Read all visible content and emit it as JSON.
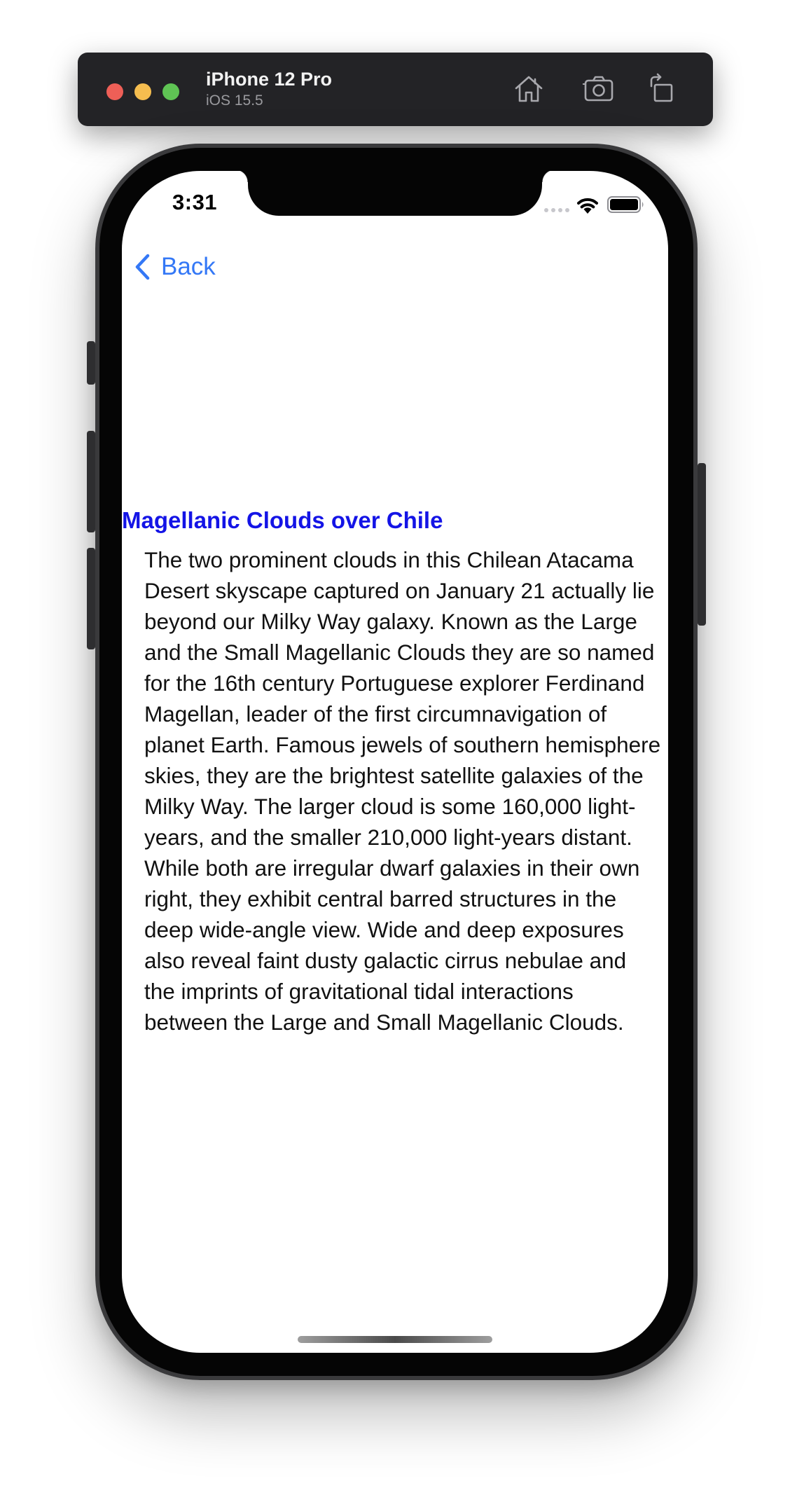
{
  "simulator": {
    "device_name": "iPhone 12 Pro",
    "os_version": "iOS 15.5",
    "toolbar_icons": [
      "home-icon",
      "screenshot-icon",
      "rotate-icon"
    ],
    "traffic_lights": [
      "close",
      "minimize",
      "zoom"
    ]
  },
  "status_bar": {
    "time": "3:31",
    "icons": [
      "signal-icon",
      "wifi-icon",
      "battery-icon"
    ]
  },
  "nav": {
    "back_label": "Back",
    "back_icon": "chevron-left-icon"
  },
  "article": {
    "title": "Magellanic Clouds over Chile",
    "body": "The two prominent clouds in this Chilean Atacama Desert skyscape captured on January 21 actually lie beyond our Milky Way galaxy.  Known as the Large and the Small Magellanic Clouds they are so named for the 16th century Portuguese explorer Ferdinand Magellan, leader of the first circumnavigation of planet Earth. Famous jewels of southern hemisphere skies, they are the brightest satellite galaxies of the Milky Way. The larger cloud is some 160,000 light-years, and the smaller 210,000 light-years distant. While both are irregular dwarf galaxies in their own right, they exhibit central barred structures in the deep wide-angle view. Wide and deep exposures also reveal faint dusty galactic cirrus nebulae and the imprints of gravitational tidal interactions between the Large and Small Magellanic Clouds."
  },
  "colors": {
    "link_blue": "#3478f6",
    "title_blue": "#1414e6",
    "toolbar_bg": "#232326"
  }
}
